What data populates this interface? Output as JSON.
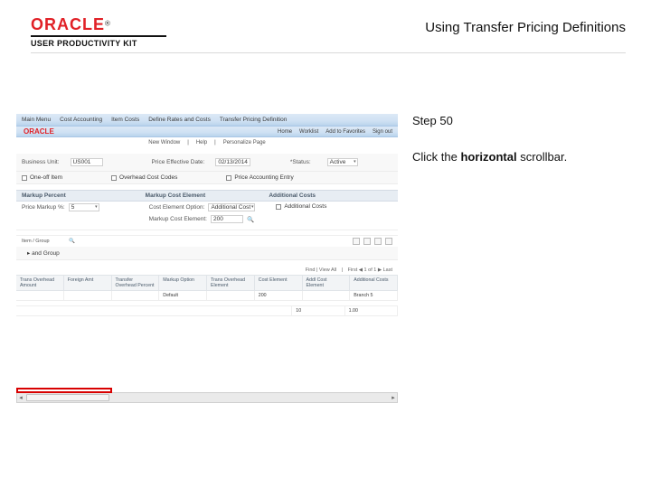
{
  "header": {
    "logo": "ORACLE",
    "logo_sup": "®",
    "subbrand": "USER PRODUCTIVITY KIT",
    "doc_title": "Using Transfer Pricing Definitions"
  },
  "instructions": {
    "step_label": "Step 50",
    "text_pre": "Click the ",
    "text_bold": "horizontal",
    "text_post": " scrollbar."
  },
  "app": {
    "brand": "ORACLE",
    "breadcrumb": [
      "Main Menu",
      "Cost Accounting",
      "Item Costs",
      "Define Rates and Costs",
      "Transfer Pricing Definition"
    ],
    "utility": [
      "Home",
      "Worklist",
      "Add to Favorites",
      "Sign out"
    ],
    "subnav": [
      "New Window",
      "Help",
      "Personalize Page"
    ],
    "params": {
      "business_unit_lbl": "Business Unit:",
      "business_unit_val": "US001",
      "eff_date_lbl": "Price Effective Date:",
      "eff_date_val": "02/13/2014",
      "status_lbl": "*Status:",
      "status_val": "Active"
    },
    "checks": {
      "one_off": "One-off Item",
      "overhead": "Overhead Cost Codes",
      "acct": "Price Accounting Entry"
    },
    "section_markup": "Markup Percent",
    "section_markup_el": "Markup Cost Element",
    "section_addl": "Additional Costs",
    "markup": {
      "price_markup_lbl": "Price Markup %:",
      "price_markup_val": "5",
      "cost_elem_opt_lbl": "Cost Element Option:",
      "cost_elem_opt_val": "Additional Cost",
      "markup_cost_elem_lbl": "Markup Cost Element:",
      "markup_cost_elem_val": "200",
      "addl_costs_lbl": "Additional Costs"
    },
    "item_group_lbl": "Item / Group",
    "views": {
      "find_lbl": "Find | View All",
      "nav": "First ◀ 1 of 1 ▶ Last"
    },
    "t1": {
      "cols": [
        "Trans Overhead Amount",
        "Foreign Amt",
        "Transfer Overhead Percent",
        "Markup Option",
        "Trans Overhead Element",
        "Cost Element",
        "Addl Cost Element",
        "Additional Costs"
      ],
      "row": [
        "",
        "",
        "",
        "Default",
        "",
        "200",
        "",
        "Branch     5"
      ]
    },
    "t2_right": [
      "10",
      "1.00"
    ]
  }
}
